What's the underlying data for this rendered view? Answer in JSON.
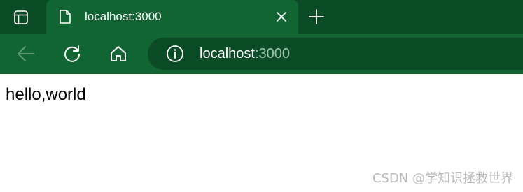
{
  "tabstrip": {
    "tab_actions_icon": "tab-actions-icon",
    "tabs": [
      {
        "title": "localhost:3000",
        "favicon": "page-icon",
        "close_icon": "close-icon"
      }
    ],
    "new_tab_icon": "plus-icon"
  },
  "toolbar": {
    "back_icon": "arrow-left-icon",
    "refresh_icon": "refresh-icon",
    "home_icon": "home-icon",
    "address": {
      "info_icon": "info-icon",
      "host": "localhost",
      "port": ":3000"
    }
  },
  "page": {
    "text": "hello,world"
  },
  "watermark": "CSDN @学知识拯救世界",
  "colors": {
    "tabstrip_bg": "#0b4b25",
    "toolbar_bg": "#106533",
    "address_bg": "#0b4b25",
    "page_bg": "#ffffff"
  }
}
